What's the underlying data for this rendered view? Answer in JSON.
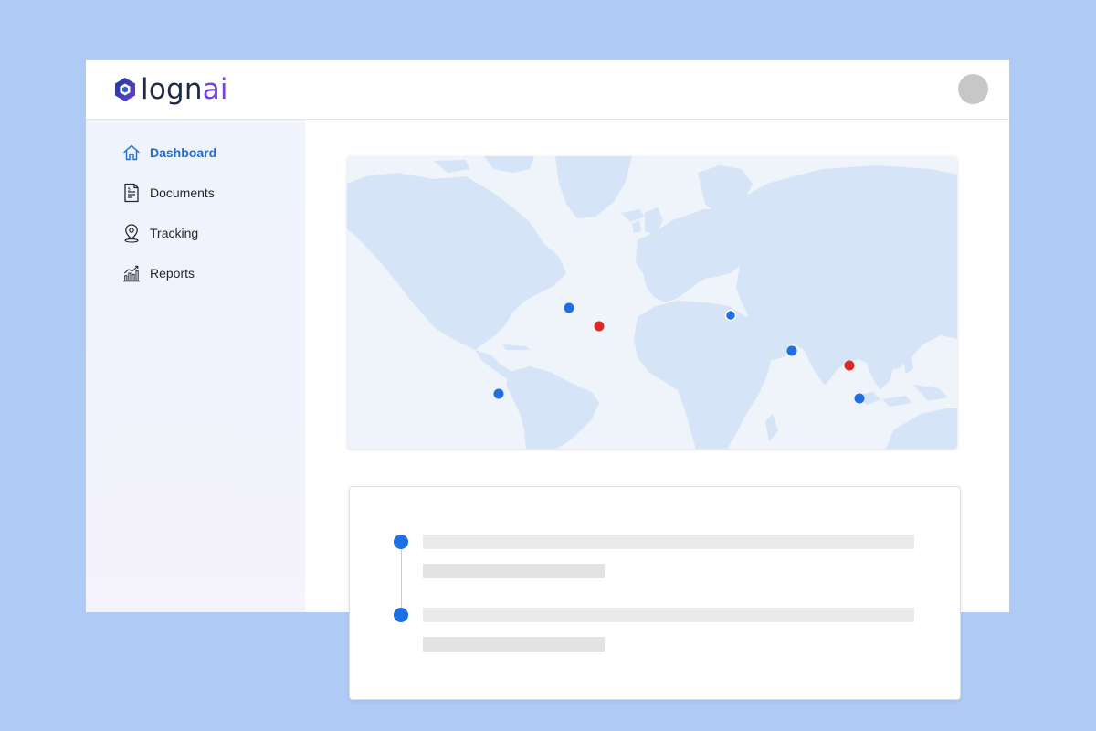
{
  "app": {
    "logo": {
      "text_main": "logn",
      "text_accent": "ai"
    },
    "colors": {
      "accent": "#1d6bd8",
      "brand_purple": "#7a3fe0",
      "marker_blue": "#1f6fe0",
      "marker_red": "#d92b23",
      "land": "#d6e4f8"
    }
  },
  "header": {
    "avatar": "user-avatar"
  },
  "sidebar": {
    "items": [
      {
        "label": "Dashboard",
        "icon": "home-icon",
        "active": true
      },
      {
        "label": "Documents",
        "icon": "document-icon",
        "active": false
      },
      {
        "label": "Tracking",
        "icon": "location-pin-icon",
        "active": false
      },
      {
        "label": "Reports",
        "icon": "chart-icon",
        "active": false
      }
    ]
  },
  "map": {
    "markers": [
      {
        "name": "atlantic-north",
        "status": "blue"
      },
      {
        "name": "atlantic-mid",
        "status": "red"
      },
      {
        "name": "mediterranean-east",
        "status": "blue"
      },
      {
        "name": "arabian-sea",
        "status": "blue"
      },
      {
        "name": "bay-of-bengal",
        "status": "red"
      },
      {
        "name": "indonesia",
        "status": "blue"
      },
      {
        "name": "pacific-south-america",
        "status": "blue"
      }
    ]
  },
  "timeline": {
    "events": 2
  }
}
